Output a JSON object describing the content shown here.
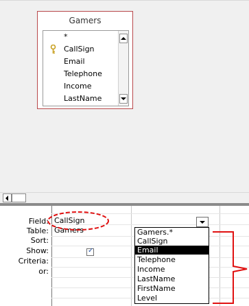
{
  "table": {
    "title": "Gamers",
    "fields": [
      "*",
      "CallSign",
      "Email",
      "Telephone",
      "Income",
      "LastName"
    ],
    "primary_key": "CallSign"
  },
  "grid": {
    "row_labels": [
      "Field:",
      "Table:",
      "Sort:",
      "Show:",
      "Criteria:",
      "or:"
    ],
    "field_value": "CallSign",
    "table_value": "Gamers",
    "show_checked": true,
    "check_glyph": "✓"
  },
  "dropdown": {
    "options": [
      "Gamers.*",
      "CallSign",
      "Email",
      "Telephone",
      "Income",
      "LastName",
      "FirstName",
      "Level"
    ],
    "selected": "Email"
  },
  "colors": {
    "table_border": "#b8474a",
    "annotation": "#e01010",
    "key_icon": "#c8a020"
  }
}
